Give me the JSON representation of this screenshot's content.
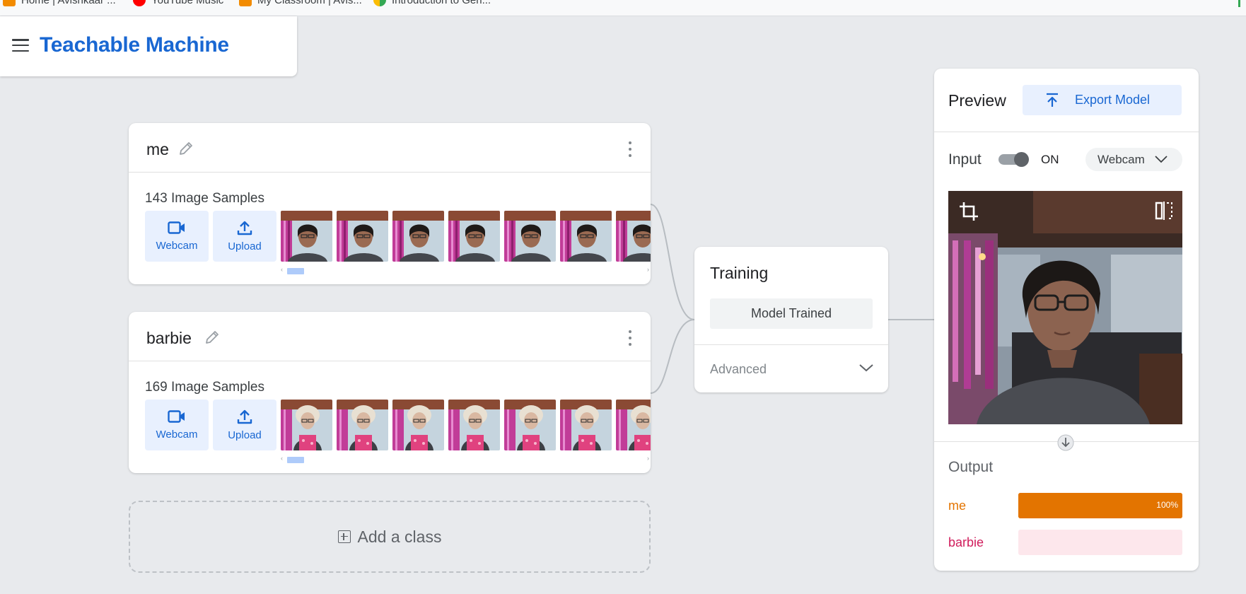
{
  "bookmarks": [
    {
      "label": "Home | Avishkaar ...",
      "icon": "avishkaar-icon"
    },
    {
      "label": "YouTube Music",
      "icon": "youtube-music-icon"
    },
    {
      "label": "My Classroom | Avis...",
      "icon": "avishkaar-icon"
    },
    {
      "label": "Introduction to Gen...",
      "icon": "google-icon"
    }
  ],
  "header": {
    "title": "Teachable Machine"
  },
  "classes": [
    {
      "name": "me",
      "samples": "143 Image Samples",
      "webcam_label": "Webcam",
      "upload_label": "Upload"
    },
    {
      "name": "barbie",
      "samples": "169 Image Samples",
      "webcam_label": "Webcam",
      "upload_label": "Upload"
    }
  ],
  "add_class": {
    "label": "Add a class"
  },
  "training": {
    "title": "Training",
    "button": "Model Trained",
    "advanced": "Advanced"
  },
  "preview": {
    "title": "Preview",
    "export_label": "Export Model",
    "input_label": "Input",
    "toggle_state": "ON",
    "source": "Webcam",
    "output_label": "Output",
    "outputs": [
      {
        "label": "me",
        "percent": 100,
        "percent_text": "100%",
        "color": "#e37400",
        "track": "#e37400"
      },
      {
        "label": "barbie",
        "percent": 0,
        "percent_text": "",
        "color": "#d01c5b",
        "track": "#fde7ec"
      }
    ]
  },
  "colors": {
    "accent": "#1967d2",
    "background": "#e8eaed"
  }
}
